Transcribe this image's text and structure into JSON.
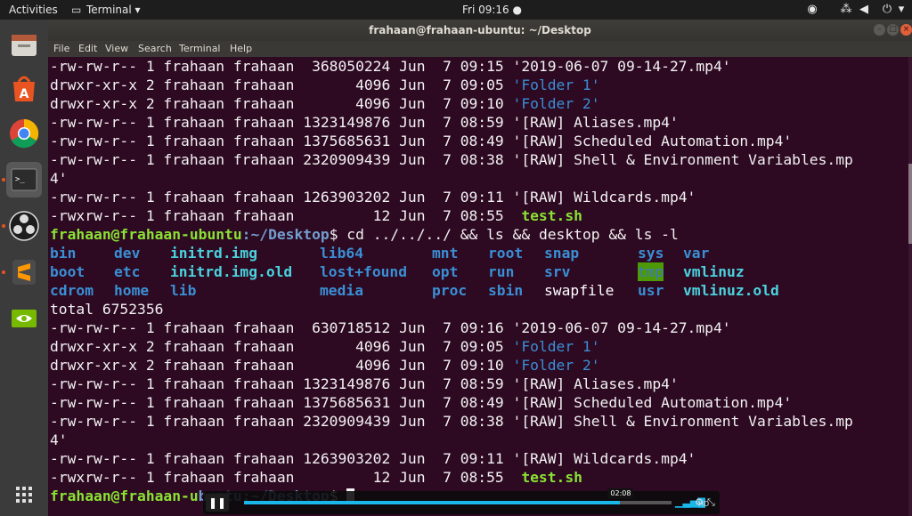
{
  "topbar": {
    "activities": "Activities",
    "app_menu": "Terminal ▾",
    "clock": "Fri 09:16 ●",
    "icons": [
      "obs-tray-icon",
      "network-icon",
      "volume-icon",
      "power-icon",
      "chevron-down-icon"
    ]
  },
  "dock": {
    "items": [
      "files-icon",
      "software-center-icon",
      "chrome-icon",
      "terminal-icon",
      "obs-icon",
      "sublime-text-icon",
      "nvidia-icon"
    ],
    "apps_grid": "show-applications-icon"
  },
  "window": {
    "title": "frahaan@frahaan-ubuntu: ~/Desktop",
    "controls": [
      "minimize",
      "maximize",
      "close"
    ]
  },
  "menu": [
    "File",
    "Edit",
    "View",
    "Search",
    "Terminal",
    "Help"
  ],
  "terminal": {
    "listing1": [
      [
        "-rw-rw-r-- 1 frahaan frahaan  368050224 Jun  7 09:15 ",
        "'2019-06-07 09-14-27.mp4'",
        "q"
      ],
      [
        "drwxr-xr-x 2 frahaan frahaan       4096 Jun  7 09:05 ",
        "'Folder 1'",
        "dir"
      ],
      [
        "drwxr-xr-x 2 frahaan frahaan       4096 Jun  7 09:10 ",
        "'Folder 2'",
        "dir"
      ],
      [
        "-rw-rw-r-- 1 frahaan frahaan 1323149876 Jun  7 08:59 ",
        "'[RAW] Aliases.mp4'",
        "q"
      ],
      [
        "-rw-rw-r-- 1 frahaan frahaan 1375685631 Jun  7 08:49 ",
        "'[RAW] Scheduled Automation.mp4'",
        "q"
      ],
      [
        "-rw-rw-r-- 1 frahaan frahaan 2320909439 Jun  7 08:38 ",
        "'[RAW] Shell & Environment Variables.mp",
        "q"
      ],
      [
        "4'",
        "",
        "q"
      ],
      [
        "-rw-rw-r-- 1 frahaan frahaan 1263903202 Jun  7 09:11 ",
        "'[RAW] Wildcards.mp4'",
        "q"
      ],
      [
        "-rwxrw-r-- 1 frahaan frahaan         12 Jun  7 08:55  ",
        "test.sh",
        "exe"
      ]
    ],
    "prompt_user": "frahaan@frahaan-ubuntu",
    "prompt_path": ":~/Desktop",
    "prompt_sym": "$ ",
    "command": "cd ../../../ && ls && desktop && ls -l",
    "ls_rows": [
      [
        "bin",
        "dev",
        "initrd.img",
        "lib64",
        "mnt",
        "root",
        "snap",
        "sys",
        "var"
      ],
      [
        "boot",
        "etc",
        "initrd.img.old",
        "lost+found",
        "opt",
        "run",
        "srv",
        "tmp",
        "vmlinuz"
      ],
      [
        "cdrom",
        "home",
        "lib",
        "media",
        "proc",
        "sbin",
        "swapfile",
        "usr",
        "vmlinuz.old"
      ]
    ],
    "total": "total 6752356",
    "listing2": [
      [
        "-rw-rw-r-- 1 frahaan frahaan  630718512 Jun  7 09:16 ",
        "'2019-06-07 09-14-27.mp4'",
        "q"
      ],
      [
        "drwxr-xr-x 2 frahaan frahaan       4096 Jun  7 09:05 ",
        "'Folder 1'",
        "dir"
      ],
      [
        "drwxr-xr-x 2 frahaan frahaan       4096 Jun  7 09:10 ",
        "'Folder 2'",
        "dir"
      ],
      [
        "-rw-rw-r-- 1 frahaan frahaan 1323149876 Jun  7 08:59 ",
        "'[RAW] Aliases.mp4'",
        "q"
      ],
      [
        "-rw-rw-r-- 1 frahaan frahaan 1375685631 Jun  7 08:49 ",
        "'[RAW] Scheduled Automation.mp4'",
        "q"
      ],
      [
        "-rw-rw-r-- 1 frahaan frahaan 2320909439 Jun  7 08:38 ",
        "'[RAW] Shell & Environment Variables.mp",
        "q"
      ],
      [
        "4'",
        "",
        "q"
      ],
      [
        "-rw-rw-r-- 1 frahaan frahaan 1263903202 Jun  7 09:11 ",
        "'[RAW] Wildcards.mp4'",
        "q"
      ],
      [
        "-rwxrw-r-- 1 frahaan frahaan         12 Jun  7 08:55  ",
        "test.sh",
        "exe"
      ]
    ],
    "final_prompt_user": "frahaan@frahaan-u",
    "final_prompt_path": "buntu:~/Desktop",
    "final_prompt_sym": "$ "
  },
  "video_player": {
    "time": "02:08",
    "progress": 0.88,
    "icons": [
      "pause-icon",
      "volume-bars-icon",
      "hd-icon",
      "settings-icon",
      "fullscreen-icon"
    ]
  },
  "colors": {
    "terminal_bg": "#2d0922",
    "dir_blue": "#3a8fd4",
    "exe_green": "#8ae234",
    "ls_cyan": "#4ad3dd",
    "tmp_highlight": "#4e9a06"
  }
}
